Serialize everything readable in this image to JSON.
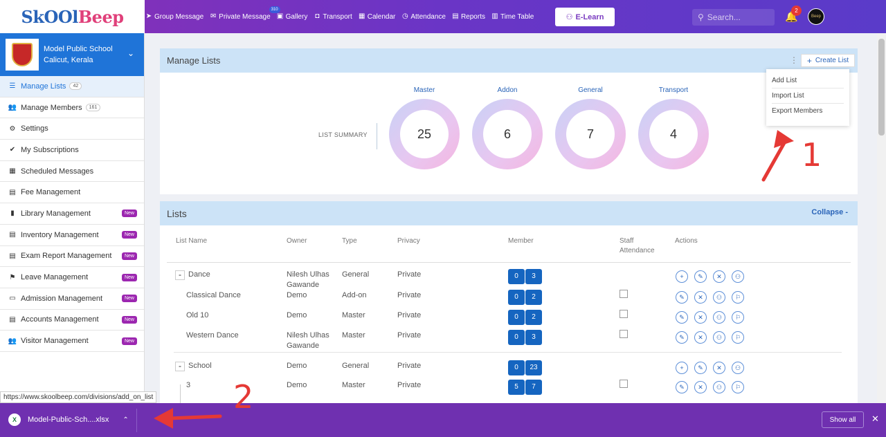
{
  "logo": {
    "sk": "Sk",
    "oo": "OO",
    "l": "l",
    "beep": "Beep"
  },
  "nav": [
    {
      "label": "Group Message",
      "icon": "paper-plane-icon",
      "glyph": "➤"
    },
    {
      "label": "Private Message",
      "icon": "envelope-icon",
      "glyph": "✉",
      "badge": "310"
    },
    {
      "label": "Gallery",
      "icon": "image-icon",
      "glyph": "▣"
    },
    {
      "label": "Transport",
      "icon": "bus-icon",
      "glyph": "◘"
    },
    {
      "label": "Calendar",
      "icon": "calendar-icon",
      "glyph": "▦"
    },
    {
      "label": "Attendance",
      "icon": "clock-icon",
      "glyph": "◷"
    },
    {
      "label": "Reports",
      "icon": "report-icon",
      "glyph": "▤"
    },
    {
      "label": "Time Table",
      "icon": "timetable-icon",
      "glyph": "▥"
    }
  ],
  "elearn": "E-Learn",
  "search_placeholder": "Search...",
  "notification_count": "2",
  "avatar_text": "Beep",
  "school": {
    "name": "Model Public School",
    "location": "Calicut, Kerala"
  },
  "sidebar": [
    {
      "label": "Manage Lists",
      "icon": "list-icon",
      "glyph": "☰",
      "count": "42",
      "active": true
    },
    {
      "label": "Manage Members",
      "icon": "users-icon",
      "glyph": "👥",
      "count": "161"
    },
    {
      "label": "Settings",
      "icon": "gear-icon",
      "glyph": "⚙"
    },
    {
      "label": "My Subscriptions",
      "icon": "check-double-icon",
      "glyph": "✔"
    },
    {
      "label": "Scheduled Messages",
      "icon": "calendar-icon",
      "glyph": "▦"
    },
    {
      "label": "Fee Management",
      "icon": "file-icon",
      "glyph": "▤"
    },
    {
      "label": "Library Management",
      "icon": "book-icon",
      "glyph": "▮",
      "new": "New"
    },
    {
      "label": "Inventory Management",
      "icon": "inventory-icon",
      "glyph": "▤",
      "new": "New"
    },
    {
      "label": "Exam Report Management",
      "icon": "file-icon",
      "glyph": "▤",
      "new": "New"
    },
    {
      "label": "Leave Management",
      "icon": "user-leave-icon",
      "glyph": "⚑",
      "new": "New"
    },
    {
      "label": "Admission Management",
      "icon": "id-card-icon",
      "glyph": "▭",
      "new": "New"
    },
    {
      "label": "Accounts Management",
      "icon": "file-icon",
      "glyph": "▤",
      "new": "New"
    },
    {
      "label": "Visitor Management",
      "icon": "users-icon",
      "glyph": "👥",
      "new": "New"
    }
  ],
  "manage_lists": {
    "title": "Manage Lists",
    "create_button": "Create List",
    "summary_label": "LIST SUMMARY",
    "summary": [
      {
        "name": "Master",
        "value": "25"
      },
      {
        "name": "Addon",
        "value": "6"
      },
      {
        "name": "General",
        "value": "7"
      },
      {
        "name": "Transport",
        "value": "4"
      }
    ],
    "dropdown": [
      "Add List",
      "Import List",
      "Export Members"
    ]
  },
  "lists": {
    "title": "Lists",
    "collapse": "Collapse -",
    "headers": {
      "name": "List Name",
      "owner": "Owner",
      "type": "Type",
      "privacy": "Privacy",
      "member": "Member",
      "staff": "Staff Attendance",
      "actions": "Actions"
    },
    "rows": [
      {
        "name": "Dance",
        "owner": "Nilesh Ulhas Gawande",
        "type": "General",
        "privacy": "Private",
        "m1": "0",
        "m2": "3",
        "parent": true
      },
      {
        "name": "Classical Dance",
        "owner": "Demo",
        "type": "Add-on",
        "privacy": "Private",
        "m1": "0",
        "m2": "2"
      },
      {
        "name": "Old 10",
        "owner": "Demo",
        "type": "Master",
        "privacy": "Private",
        "m1": "0",
        "m2": "2"
      },
      {
        "name": "Western Dance",
        "owner": "Nilesh Ulhas Gawande",
        "type": "Master",
        "privacy": "Private",
        "m1": "0",
        "m2": "3"
      },
      {
        "name": "School",
        "owner": "Demo",
        "type": "General",
        "privacy": "Private",
        "m1": "0",
        "m2": "23",
        "parent": true
      },
      {
        "name": "3",
        "owner": "Demo",
        "type": "Master",
        "privacy": "Private",
        "m1": "5",
        "m2": "7"
      }
    ]
  },
  "status_url": "https://www.skoolbeep.com/divisions/add_on_list",
  "download": {
    "filename": "Model-Public-Sch....xlsx",
    "show_all": "Show all"
  },
  "annotations": [
    "1",
    "2"
  ],
  "colors": {
    "accent": "#1f74d8",
    "topbar": "#6a35c6",
    "badge_new": "#9c27b0",
    "annotation": "#e53935"
  }
}
